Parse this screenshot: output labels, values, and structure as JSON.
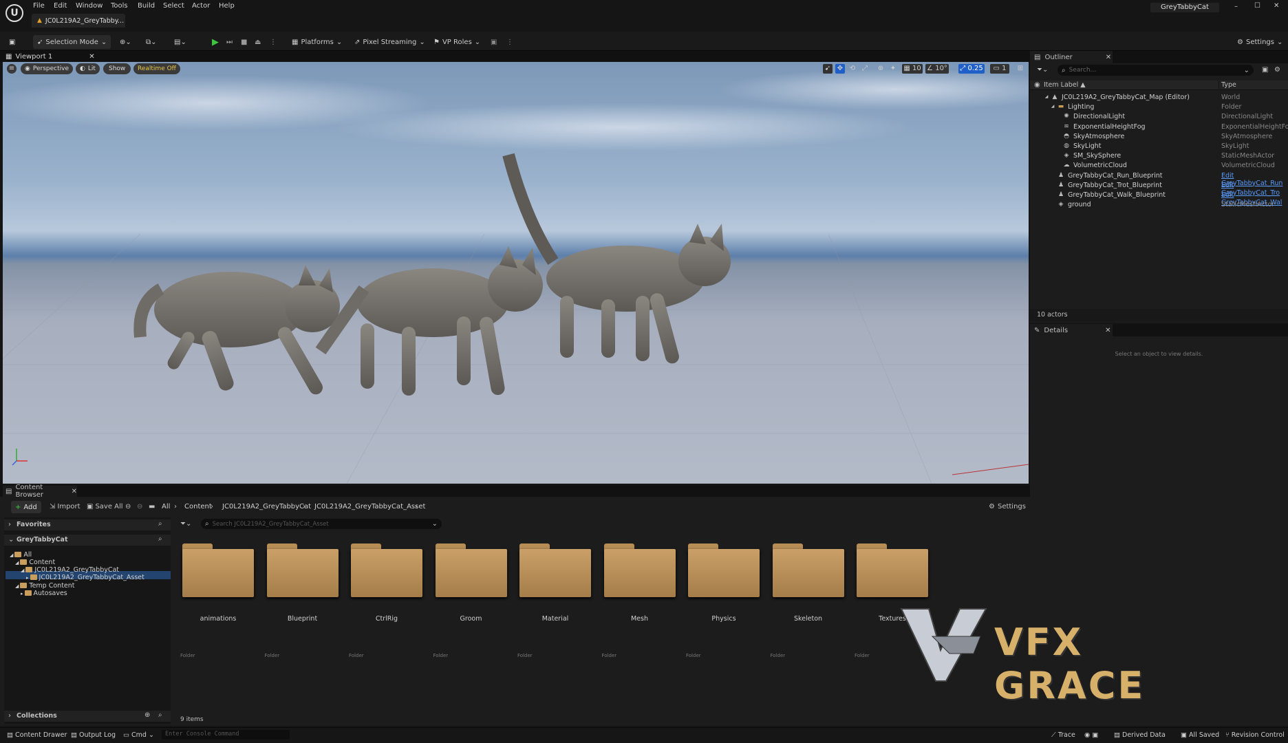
{
  "app": {
    "window_title": "GreyTabbyCat",
    "document_tab": "JC0L219A2_GreyTabby...",
    "menus": [
      "File",
      "Edit",
      "Window",
      "Tools",
      "Build",
      "Select",
      "Actor",
      "Help"
    ],
    "window_controls": {
      "minimize": "–",
      "maximize": "☐",
      "close": "✕"
    }
  },
  "toolbar": {
    "selection_mode": "Selection Mode",
    "platforms": "Platforms",
    "pixel_streaming": "Pixel Streaming",
    "vp_roles": "VP Roles",
    "settings": "Settings"
  },
  "viewport": {
    "tab": "Viewport 1",
    "perspective": "Perspective",
    "lit": "Lit",
    "show": "Show",
    "realtime": "Realtime Off",
    "grid_snap": "10",
    "rot_snap": "10°",
    "scale_snap": "0.25",
    "camera_speed": "1"
  },
  "outliner": {
    "tab": "Outliner",
    "search_placeholder": "Search...",
    "col_label": "Item Label ▲",
    "col_type": "Type",
    "items": [
      {
        "label": "JC0L219A2_GreyTabbyCat_Map (Editor)",
        "type": "World",
        "indent": 0,
        "icon": "map-icon"
      },
      {
        "label": "Lighting",
        "type": "Folder",
        "indent": 1,
        "icon": "folder-icon"
      },
      {
        "label": "DirectionalLight",
        "type": "DirectionalLight",
        "indent": 2,
        "icon": "light-icon"
      },
      {
        "label": "ExponentialHeightFog",
        "type": "ExponentialHeightFog",
        "indent": 2,
        "icon": "fog-icon"
      },
      {
        "label": "SkyAtmosphere",
        "type": "SkyAtmosphere",
        "indent": 2,
        "icon": "sky-icon"
      },
      {
        "label": "SkyLight",
        "type": "SkyLight",
        "indent": 2,
        "icon": "skylight-icon"
      },
      {
        "label": "SM_SkySphere",
        "type": "StaticMeshActor",
        "indent": 2,
        "icon": "mesh-icon"
      },
      {
        "label": "VolumetricCloud",
        "type": "VolumetricCloud",
        "indent": 2,
        "icon": "cloud-icon"
      },
      {
        "label": "GreyTabbyCat_Run_Blueprint",
        "type": "Edit GreyTabbyCat_Run",
        "indent": 1,
        "icon": "pawn-icon",
        "link": true
      },
      {
        "label": "GreyTabbyCat_Trot_Blueprint",
        "type": "Edit GreyTabbyCat_Tro",
        "indent": 1,
        "icon": "pawn-icon",
        "link": true
      },
      {
        "label": "GreyTabbyCat_Walk_Blueprint",
        "type": "Edit GreyTabbyCat_Wal",
        "indent": 1,
        "icon": "pawn-icon",
        "link": true
      },
      {
        "label": "ground",
        "type": "StaticMeshActor",
        "indent": 1,
        "icon": "mesh-icon"
      }
    ],
    "count": "10 actors"
  },
  "details": {
    "tab": "Details",
    "empty": "Select an object to view details."
  },
  "content_browser": {
    "tab": "Content Browser",
    "add": "Add",
    "import": "Import",
    "save_all": "Save All",
    "settings": "Settings",
    "breadcrumb": [
      "All",
      "Content",
      "JC0L219A2_GreyTabbyCat",
      "JC0L219A2_GreyTabbyCat_Asset"
    ],
    "search_placeholder": "Search JC0L219A2_GreyTabbyCat_Asset",
    "favorites": "Favorites",
    "project": "GreyTabbyCat",
    "collections": "Collections",
    "tree": [
      "All",
      "Content",
      "JC0L219A2_GreyTabbyCat",
      "JC0L219A2_GreyTabbyCat_Asset",
      "Temp Content",
      "Autosaves"
    ],
    "folders": [
      "animations",
      "Blueprint",
      "CtrlRig",
      "Groom",
      "Material",
      "Mesh",
      "Physics",
      "Skeleton",
      "Textures"
    ],
    "folder_type": "Folder",
    "count": "9 items"
  },
  "watermark": {
    "text": "VFX GRACE"
  },
  "statusbar": {
    "content_drawer": "Content Drawer",
    "output_log": "Output Log",
    "cmd": "Cmd",
    "console_placeholder": "Enter Console Command",
    "trace": "Trace",
    "derived_data": "Derived Data",
    "all_saved": "All Saved",
    "revision_control": "Revision Control"
  }
}
